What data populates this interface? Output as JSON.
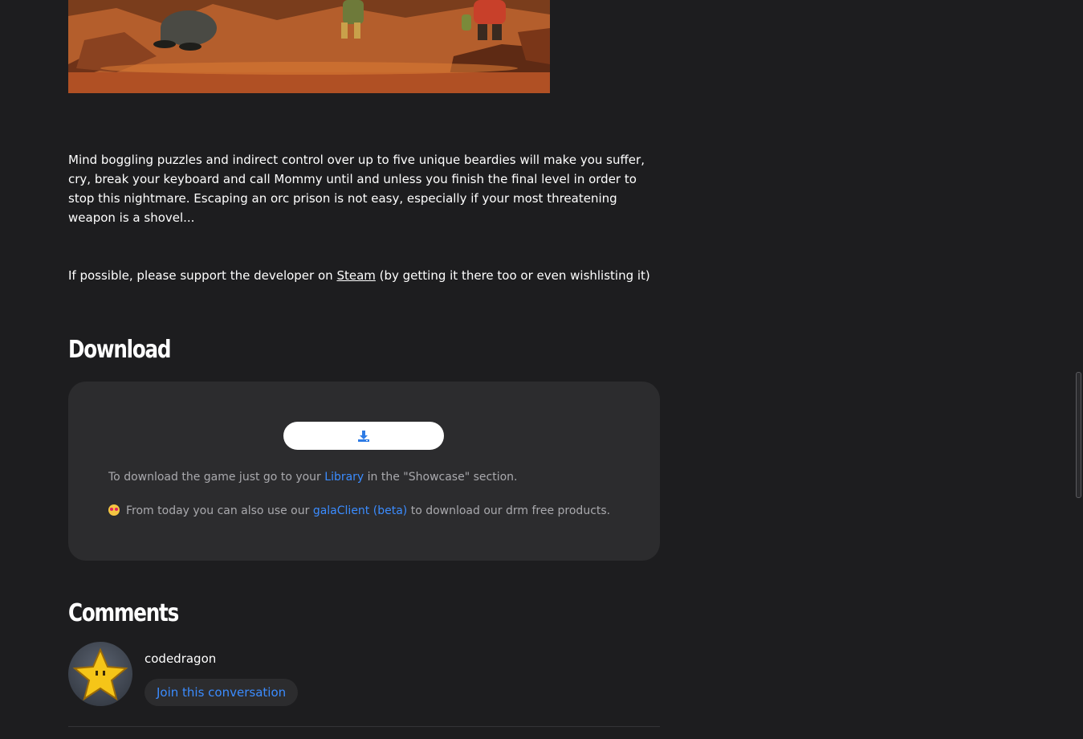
{
  "description": "Mind boggling puzzles and indirect control over up to five unique beardies will make you suffer, cry, break your keyboard and call Mommy until and unless you finish the final level in order to stop this nightmare. Escaping an orc prison is not easy, especially if your most threatening weapon is a shovel...",
  "support": {
    "before": "If possible, please support the developer on ",
    "link": "Steam",
    "after": " (by getting it there too or even wishlisting it)"
  },
  "download": {
    "title": "Download",
    "button_icon": "download-icon",
    "line1_before": "To download the game just go to your ",
    "line1_link": "Library",
    "line1_after": " in the \"Showcase\" section.",
    "line2_emoji": "star-struck-emoji-icon",
    "line2_before": "From today you can also use our ",
    "line2_link": "galaClient (beta)",
    "line2_after": " to download our drm free products."
  },
  "comments": {
    "title": "Comments",
    "username": "codedragon",
    "join_label": "Join this conversation",
    "avatar_icon": "star-avatar-icon"
  },
  "colors": {
    "background": "#1d1d1f",
    "card": "#2c2c2e",
    "link": "#3b8cff",
    "muted_text": "#a9a9ad"
  }
}
